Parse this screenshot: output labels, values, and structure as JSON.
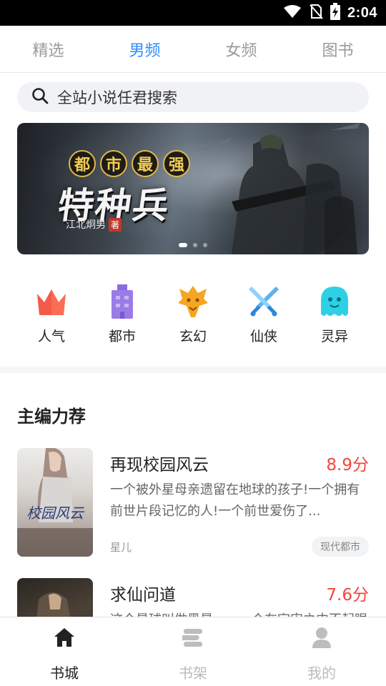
{
  "status_bar": {
    "time": "2:04",
    "icons": [
      "wifi-icon",
      "no-sim-icon",
      "battery-charging-icon"
    ]
  },
  "top_tabs": [
    {
      "label": "精选",
      "active": false
    },
    {
      "label": "男频",
      "active": true
    },
    {
      "label": "女频",
      "active": false
    },
    {
      "label": "图书",
      "active": false
    }
  ],
  "search": {
    "placeholder": "全站小说任君搜索",
    "icon": "search-icon"
  },
  "banner": {
    "tag_chars": [
      "都",
      "市",
      "最",
      "强"
    ],
    "title": "特种兵",
    "author": "江北炯男",
    "author_suffix": "著",
    "slide_count": 3,
    "active_slide": 1
  },
  "categories": [
    {
      "label": "人气",
      "icon": "crown-icon",
      "color": "#f25a4a"
    },
    {
      "label": "都市",
      "icon": "building-icon",
      "color": "#9b7be8"
    },
    {
      "label": "玄幻",
      "icon": "dragon-icon",
      "color": "#f5a623"
    },
    {
      "label": "仙侠",
      "icon": "crossed-swords-icon",
      "color": "#5fb1ee"
    },
    {
      "label": "灵异",
      "icon": "ghost-icon",
      "color": "#2ed0e6"
    }
  ],
  "section": {
    "title": "主编力荐"
  },
  "books": [
    {
      "title": "再现校园风云",
      "score": "8.9分",
      "description": "一个被外星母亲遗留在地球的孩子!一个拥有前世片段记忆的人!一个前世爱伤了...",
      "author": "星儿",
      "genre": "现代都市",
      "cover_text": "校园风云"
    },
    {
      "title": "求仙问道",
      "score": "7.6分",
      "description": "这个星球叫做黑星……一个在宇宙之中不起眼的星球",
      "author": "",
      "genre": "",
      "cover_text": ""
    }
  ],
  "bottom_nav": [
    {
      "label": "书城",
      "icon": "home-icon",
      "active": true
    },
    {
      "label": "书架",
      "icon": "bookshelf-icon",
      "active": false
    },
    {
      "label": "我的",
      "icon": "user-icon",
      "active": false
    }
  ],
  "colors": {
    "accent": "#2f8cff",
    "score": "#f2453d",
    "inactive": "#9a9a9a"
  }
}
